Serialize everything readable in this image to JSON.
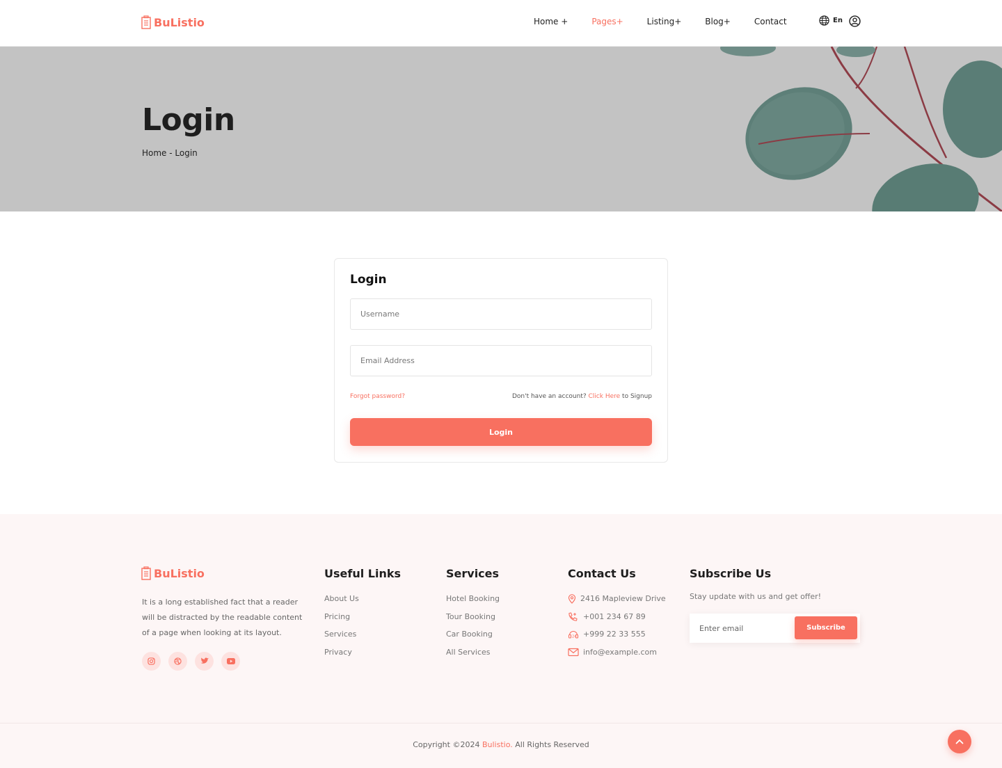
{
  "brand": {
    "name": "BuListio",
    "accent_color": "#f87060"
  },
  "nav": {
    "items": [
      {
        "label": "Home +"
      },
      {
        "label": "Pages+",
        "active": true
      },
      {
        "label": "Listing+"
      },
      {
        "label": "Blog+"
      },
      {
        "label": "Contact"
      }
    ],
    "language": "En",
    "icons": [
      "globe-icon",
      "user-circle-icon"
    ]
  },
  "banner": {
    "title": "Login",
    "breadcrumb": "Home - Login"
  },
  "login": {
    "heading": "Login",
    "username_placeholder": "Username",
    "email_placeholder": "Email Address",
    "forgot_label": "Forgot password?",
    "signup_prefix": "Don't have an account?",
    "signup_link": "Click Here",
    "signup_suffix": "to Signup",
    "button_label": "Login"
  },
  "footer": {
    "about_text": "It is a long established fact that a reader will be distracted by the readable content of a page when looking at its layout.",
    "social_icons": [
      "instagram-icon",
      "dribbble-icon",
      "twitter-icon",
      "youtube-icon"
    ],
    "useful_links": {
      "title": "Useful Links",
      "items": [
        "About Us",
        "Pricing",
        "Services",
        "Privacy"
      ]
    },
    "services": {
      "title": "Services",
      "items": [
        "Hotel Booking",
        "Tour Booking",
        "Car Booking",
        "All Services"
      ]
    },
    "contact": {
      "title": "Contact Us",
      "address": "2416 Mapleview Drive",
      "phone1": "+001 234 67 89",
      "phone2": "+999 22 33 555",
      "email": "info@example.com"
    },
    "subscribe": {
      "title": "Subscribe Us",
      "text": "Stay update with us and get offer!",
      "placeholder": "Enter email",
      "button_label": "Subscribe"
    },
    "copyright_prefix": "Copyright ©2024",
    "copyright_brand": "Bulistio.",
    "copyright_suffix": "All Rights Reserved"
  }
}
